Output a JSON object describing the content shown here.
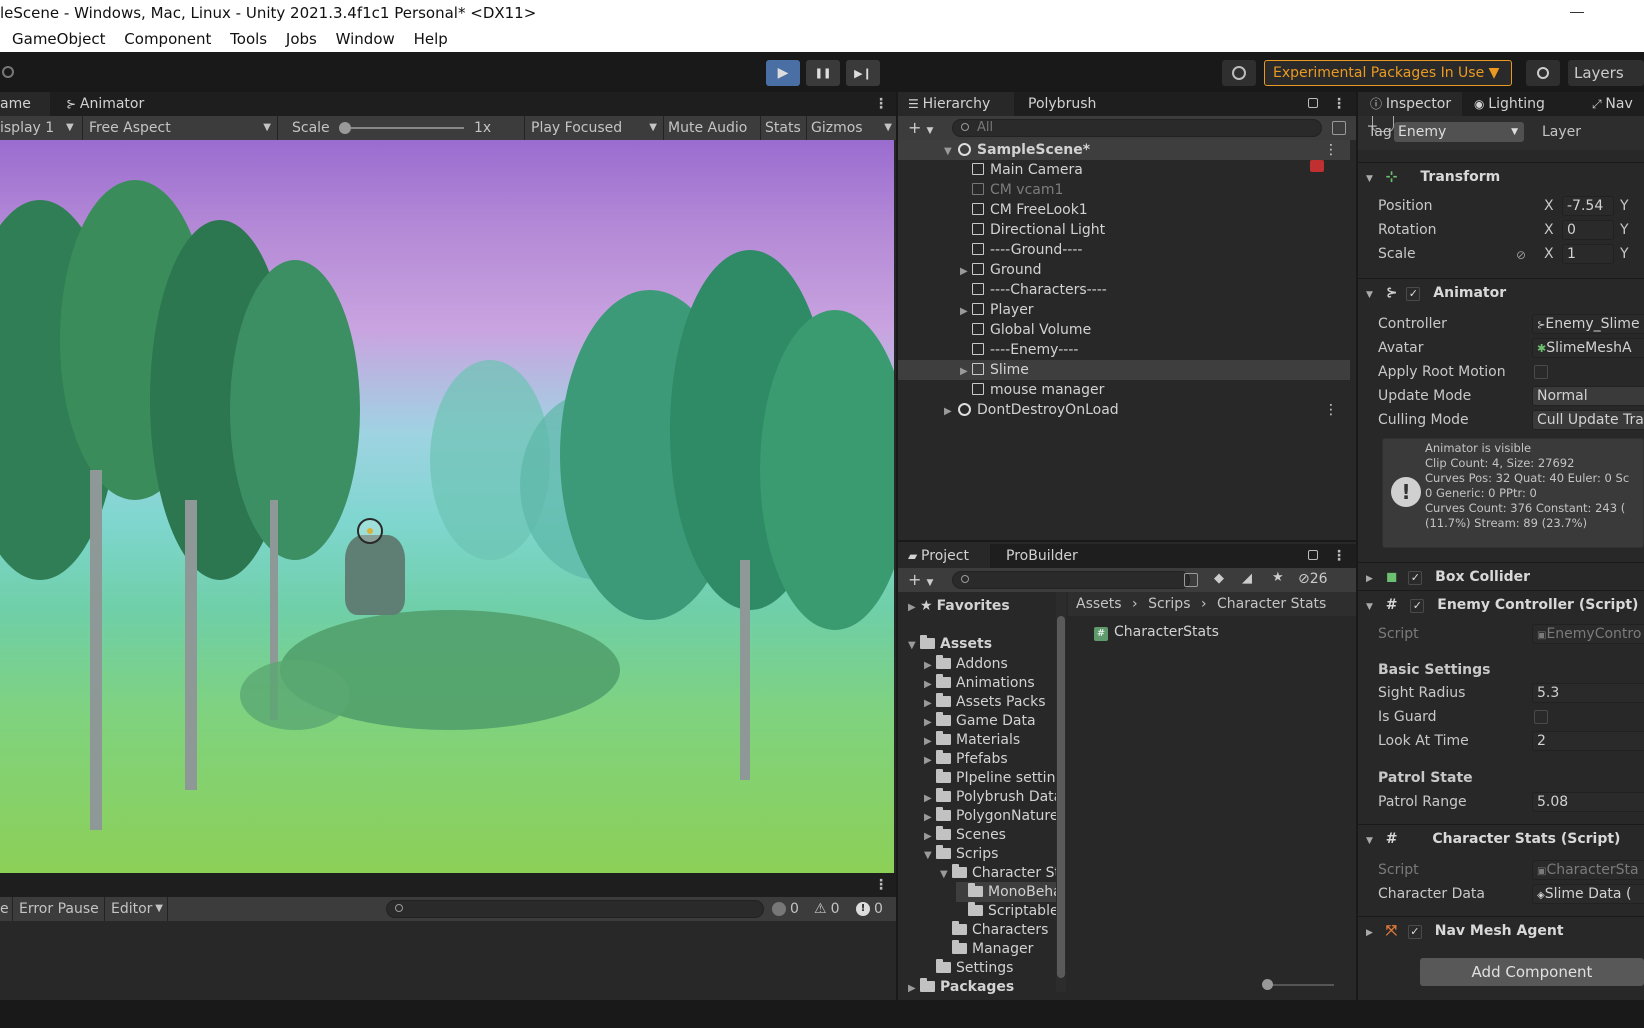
{
  "window_title": "leScene - Windows, Mac, Linux - Unity 2021.3.4f1c1 Personal* <DX11>",
  "menu": [
    "GameObject",
    "Component",
    "Tools",
    "Jobs",
    "Window",
    "Help"
  ],
  "toolbar": {
    "play_icon": "▶",
    "pause_icon": "❚❚",
    "step_icon": "▶❙",
    "experimental_label": "Experimental Packages In Use ▼",
    "layers_label": "Layers"
  },
  "game": {
    "tabs": [
      "ame",
      "Animator"
    ],
    "display": "isplay 1",
    "aspect": "Free Aspect",
    "scale_label": "Scale",
    "scale_value": "1x",
    "play_focused": "Play Focused",
    "mute": "Mute Audio",
    "stats": "Stats",
    "gizmos": "Gizmos"
  },
  "console": {
    "error_pause": "Error Pause",
    "editor": "Editor",
    "count_log": "0",
    "count_warn": "0",
    "count_error": "0",
    "first_char": "e"
  },
  "hierarchy": {
    "tabs": [
      "Hierarchy",
      "Polybrush"
    ],
    "search_placeholder": "All",
    "scene": "SampleScene*",
    "items": [
      {
        "name": "Main Camera",
        "dim": false,
        "arrow": false
      },
      {
        "name": "CM vcam1",
        "dim": true,
        "arrow": false
      },
      {
        "name": "CM FreeLook1",
        "dim": false,
        "arrow": false
      },
      {
        "name": "Directional Light",
        "dim": false,
        "arrow": false
      },
      {
        "name": "----Ground----",
        "dim": false,
        "arrow": false
      },
      {
        "name": "Ground",
        "dim": false,
        "arrow": true
      },
      {
        "name": "----Characters----",
        "dim": false,
        "arrow": false
      },
      {
        "name": "Player",
        "dim": false,
        "arrow": true
      },
      {
        "name": "Global Volume",
        "dim": false,
        "arrow": false
      },
      {
        "name": "----Enemy----",
        "dim": false,
        "arrow": false
      },
      {
        "name": "Slime",
        "dim": false,
        "arrow": true,
        "selected": true
      },
      {
        "name": "mouse manager",
        "dim": false,
        "arrow": false
      }
    ],
    "dont_destroy": "DontDestroyOnLoad"
  },
  "project": {
    "tabs": [
      "Project",
      "ProBuilder"
    ],
    "hidden_count": "26",
    "favorites": "Favorites",
    "assets": "Assets",
    "folders": [
      "Addons",
      "Animations",
      "Assets Packs",
      "Game Data",
      "Materials",
      "Pfefabs",
      "PIpeline setting",
      "Polybrush Data",
      "PolygonNature",
      "Scenes",
      "Scrips",
      "Character St",
      "MonoBeha",
      "Scriptable",
      "Characters",
      "Manager",
      "Settings",
      "Packages"
    ],
    "breadcrumb": [
      "Assets",
      "Scrips",
      "Character Stats"
    ],
    "file": "CharacterStats"
  },
  "inspector": {
    "tabs": [
      "Inspector",
      "Lighting",
      "Nav"
    ],
    "tag_label": "Tag",
    "tag_value": "Enemy",
    "layer_label": "Layer",
    "transform": {
      "title": "Transform",
      "position_label": "Position",
      "position_x": "-7.54",
      "rotation_label": "Rotation",
      "rotation_x": "0",
      "scale_label": "Scale",
      "scale_x": "1",
      "x": "X",
      "y": "Y"
    },
    "animator": {
      "title": "Animator",
      "controller_label": "Controller",
      "controller_value": "Enemy_Slime",
      "avatar_label": "Avatar",
      "avatar_value": "SlimeMeshA",
      "root_motion_label": "Apply Root Motion",
      "update_mode_label": "Update Mode",
      "update_mode_value": "Normal",
      "culling_label": "Culling Mode",
      "culling_value": "Cull Update Tra",
      "info_lines": [
        "Animator is visible",
        "Clip Count: 4, Size: 27692",
        "Curves Pos: 32 Quat: 40 Euler: 0 Sc",
        "0 Generic: 0 PPtr: 0",
        "Curves Count: 376 Constant: 243 (",
        "(11.7%) Stream: 89 (23.7%)"
      ]
    },
    "box_collider": "Box Collider",
    "enemy_controller": {
      "title": "Enemy Controller (Script)",
      "script_label": "Script",
      "script_value": "EnemyContro",
      "basic": "Basic Settings",
      "sight_label": "Sight Radius",
      "sight_value": "5.3",
      "guard_label": "Is Guard",
      "look_label": "Look At Time",
      "look_value": "2",
      "patrol": "Patrol State",
      "range_label": "Patrol Range",
      "range_value": "5.08"
    },
    "character_stats": {
      "title": "Character Stats (Script)",
      "script_label": "Script",
      "script_value": "CharacterSta",
      "data_label": "Character Data",
      "data_value": "Slime Data ("
    },
    "nav_mesh": "Nav Mesh Agent",
    "add_component": "Add Component"
  },
  "colors": {
    "accent": "#ea9a23",
    "play_active": "#4a6fa5",
    "panel": "#282828",
    "sky": "#9a6cd0",
    "grass": "#8cd057"
  }
}
